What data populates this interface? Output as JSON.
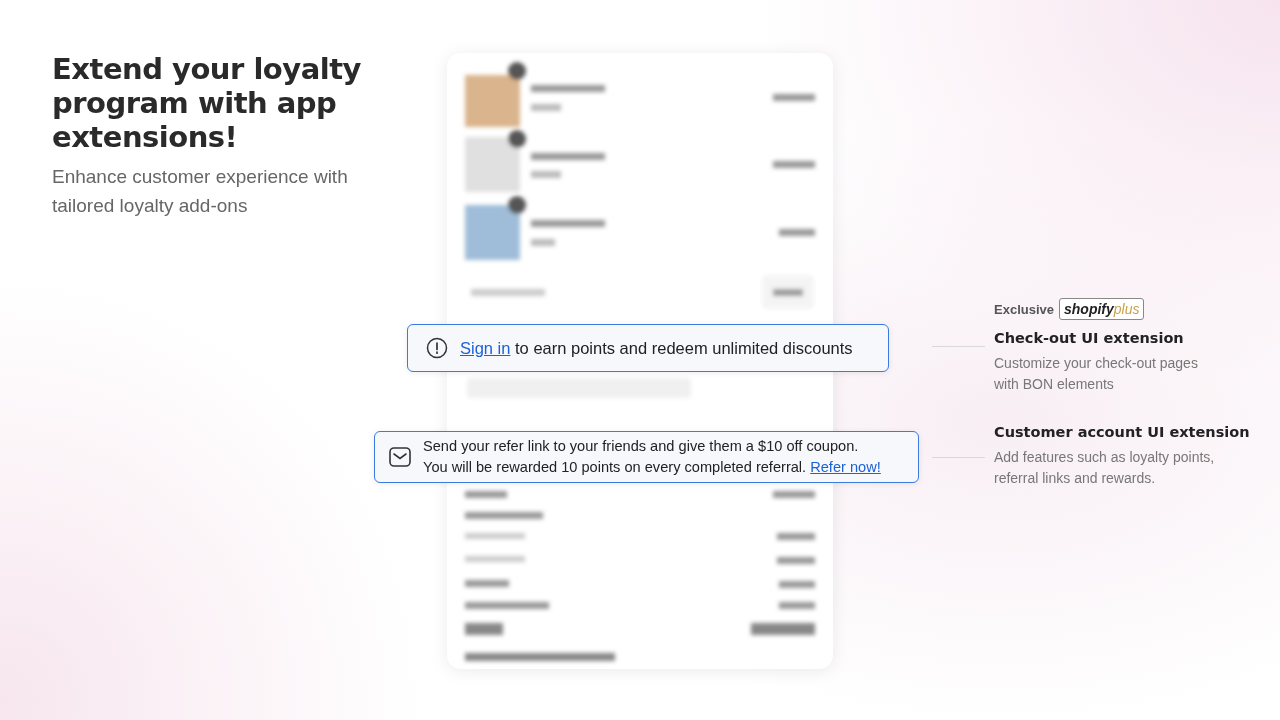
{
  "hero": {
    "title": "Extend your loyalty program with app extensions!",
    "subtitle": "Enhance customer experience with tailored loyalty add-ons"
  },
  "signin_banner": {
    "link": "Sign in",
    "text": " to earn points and redeem unlimited discounts"
  },
  "referral_banner": {
    "line_1": "Send your refer link to your friends and give them a $10 off coupon.",
    "line_2": "You will be rewarded 10 points on every completed referral.",
    "link": "Refer now!"
  },
  "features": [
    {
      "badge_label": "Exclusive",
      "badge_brand": "shopify",
      "badge_tier": "plus",
      "title": "Check-out UI extension",
      "description": "Customize your check-out pages with BON elements"
    },
    {
      "title": "Customer account UI extension",
      "description": "Add features such as loyalty points, referral links and rewards."
    }
  ]
}
